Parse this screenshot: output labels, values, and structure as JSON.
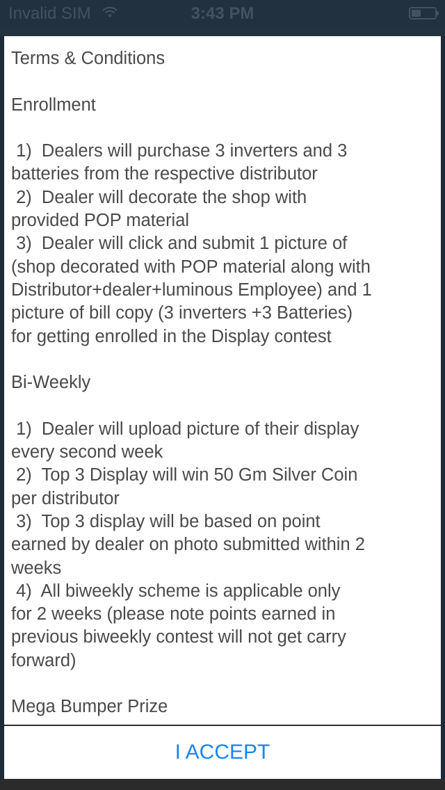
{
  "status_bar": {
    "carrier": "Invalid SIM",
    "wifi_icon": "wifi-icon",
    "time": "3:43 PM",
    "battery_level": 0.4
  },
  "dialog": {
    "lines": [
      "Terms & Conditions",
      "",
      "Enrollment",
      "",
      " 1)  Dealers will purchase 3 inverters and 3",
      "batteries from the respective distributor",
      " 2)  Dealer will decorate the shop with",
      "provided POP material",
      " 3)  Dealer will click and submit 1 picture of",
      "(shop decorated with POP material along with",
      "Distributor+dealer+luminous Employee) and 1",
      "picture of bill copy (3 inverters +3 Batteries)",
      "for getting enrolled in the Display contest",
      "",
      "Bi-Weekly",
      "",
      " 1)  Dealer will upload picture of their display",
      "every second week",
      " 2)  Top 3 Display will win 50 Gm Silver Coin",
      "per distributor",
      " 3)  Top 3 display will be based on point",
      "earned by dealer on photo submitted within 2",
      "weeks",
      " 4)  All biweekly scheme is applicable only",
      "for 2 weeks (please note points earned in",
      "previous biweekly contest will not get carry",
      "forward)",
      "",
      "Mega Bumper Prize"
    ],
    "accept_label": "I ACCEPT"
  }
}
